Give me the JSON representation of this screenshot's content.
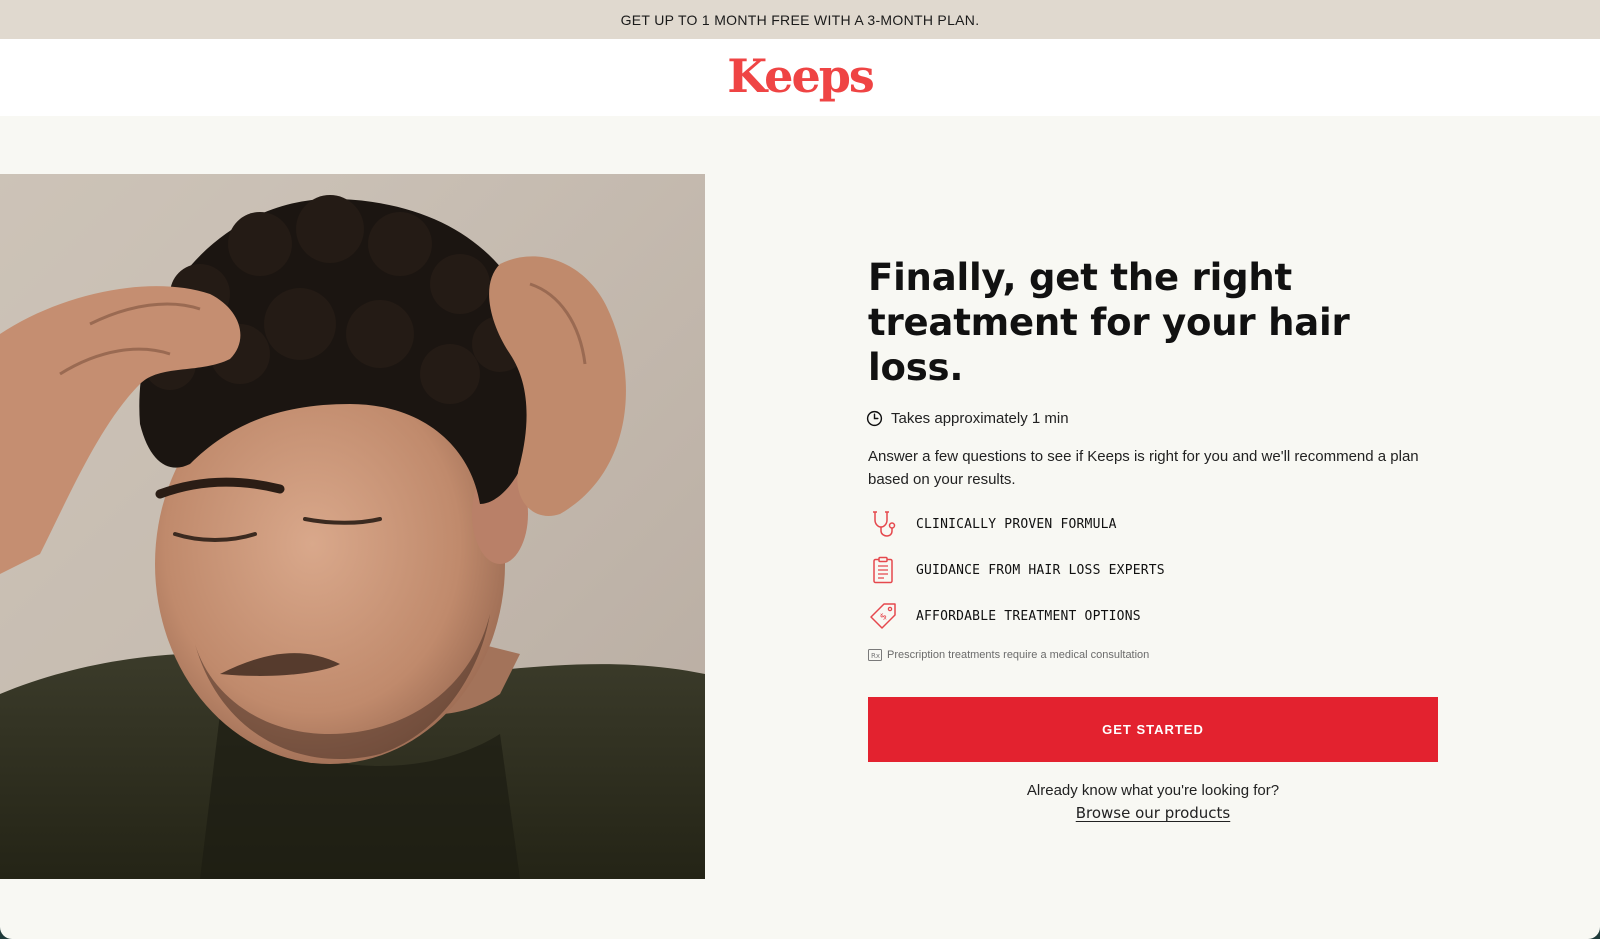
{
  "promo": {
    "text": "GET UP TO 1 MONTH FREE WITH A 3-MONTH PLAN."
  },
  "header": {
    "logo_text": "Keeps"
  },
  "hero": {
    "headline": "Finally, get the right treatment for your hair loss.",
    "time_text": "Takes approximately 1 min",
    "intro": "Answer a few questions to see if Keeps is right for you and we'll recommend a plan based on your results.",
    "features": [
      {
        "icon": "stethoscope-icon",
        "label": "CLINICALLY PROVEN FORMULA"
      },
      {
        "icon": "clipboard-icon",
        "label": "GUIDANCE FROM HAIR LOSS EXPERTS"
      },
      {
        "icon": "price-tag-icon",
        "label": "AFFORDABLE TREATMENT OPTIONS"
      }
    ],
    "rx_note": "Prescription treatments require a medical consultation",
    "cta_label": "GET STARTED",
    "already_text": "Already know what you're looking for?",
    "browse_link": "Browse our products"
  },
  "colors": {
    "brand_red": "#ef4444",
    "cta_red": "#e3222f",
    "promo_bg": "#e0d9cf",
    "page_bg": "#f8f8f3"
  }
}
